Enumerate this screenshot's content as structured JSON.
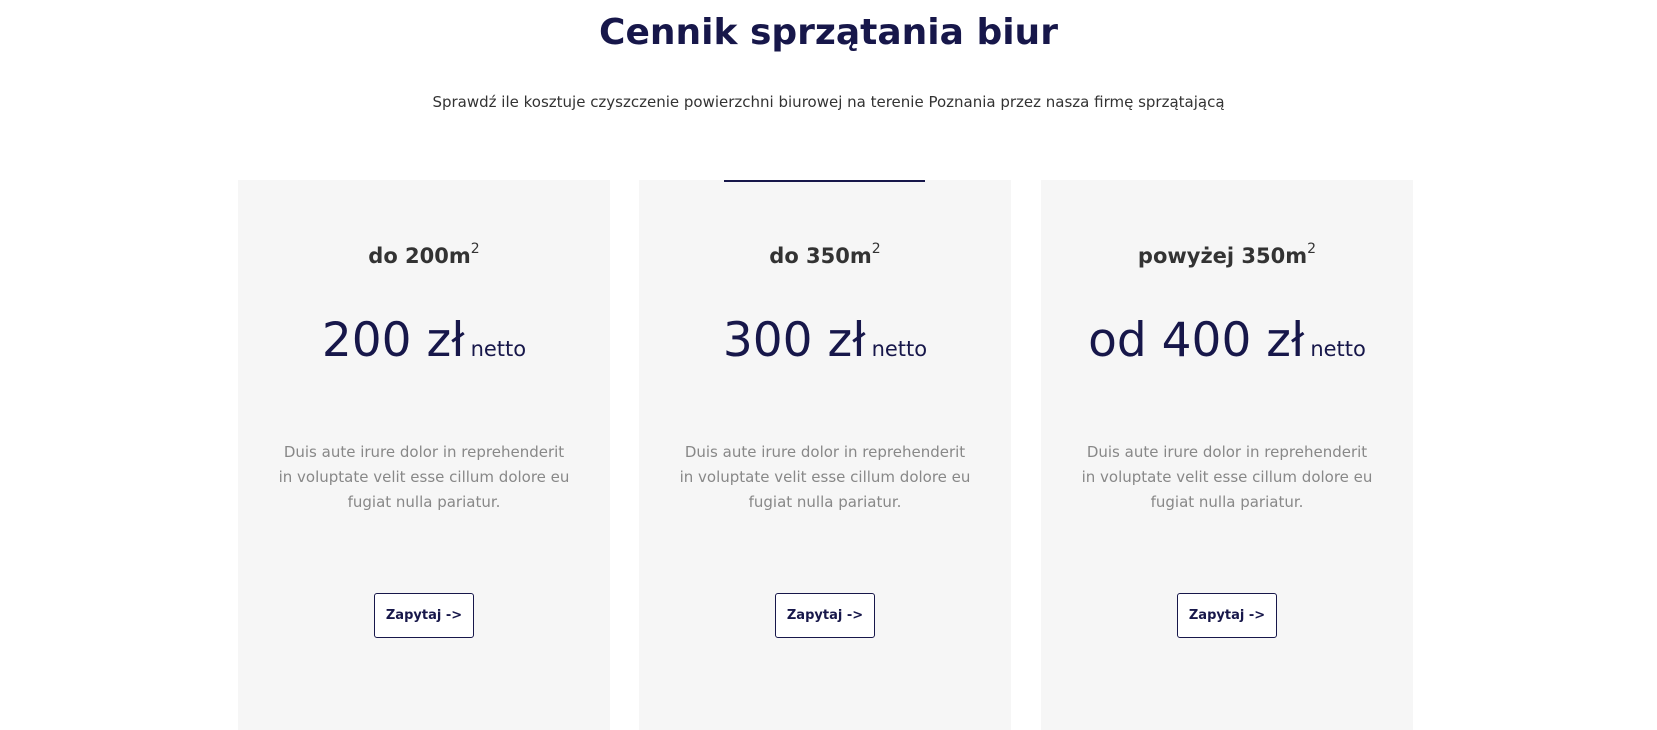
{
  "title": "Cennik sprzątania biur",
  "subtitle": "Sprawdź ile kosztuje czyszczenie powierzchni biurowej na terenie Poznania przez nasza firmę sprzątającą",
  "colors": {
    "accent": "#17174a",
    "card_bg": "#f6f6f6"
  },
  "plans": [
    {
      "name": "do 200m",
      "sup": "2",
      "price": "200 zł",
      "unit": "netto",
      "desc": "Duis aute irure dolor in reprehenderit in voluptate velit esse cillum dolore eu fugiat nulla pariatur.",
      "button": "Zapytaj ->"
    },
    {
      "name": "do 350m",
      "sup": "2",
      "price": "300 zł",
      "unit": "netto",
      "desc": "Duis aute irure dolor in reprehenderit in voluptate velit esse cillum dolore eu fugiat nulla pariatur.",
      "button": "Zapytaj ->"
    },
    {
      "name": "powyżej 350m",
      "sup": "2",
      "price": "od 400 zł",
      "unit": "netto",
      "desc": "Duis aute irure dolor in reprehenderit in voluptate velit esse cillum dolore eu fugiat nulla pariatur.",
      "button": "Zapytaj ->"
    }
  ]
}
